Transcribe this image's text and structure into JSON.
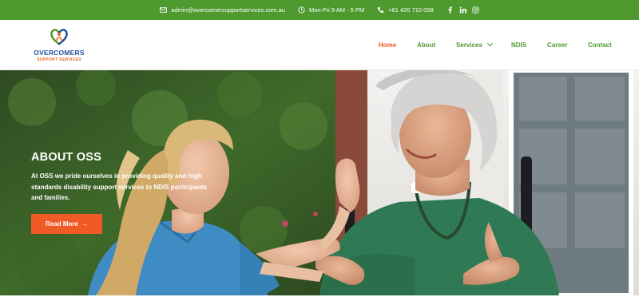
{
  "topbar": {
    "email": "admin@overcomersupportservices.com.au",
    "hours": "Mon-Fri 9 AM - 5 PM",
    "phone": "+61 420 710 058",
    "social": [
      "f",
      "in",
      "ig"
    ]
  },
  "logo": {
    "line1": "OVERCOMERS",
    "line2": "SUPPORT SERVICES"
  },
  "nav": {
    "home": "Home",
    "about": "About",
    "services": "Services",
    "ndis": "NDIS",
    "career": "Career",
    "contact": "Contact"
  },
  "hero": {
    "title": "ABOUT OSS",
    "text": "At OSS we pride ourselves in providing quality and high standards disability support services to NDIS participants and families.",
    "button": "Read More",
    "button_arrow": "→"
  },
  "colors": {
    "brand_green": "#4e9a2f",
    "accent_orange": "#f05a24",
    "logo_blue": "#1f4e9c"
  }
}
